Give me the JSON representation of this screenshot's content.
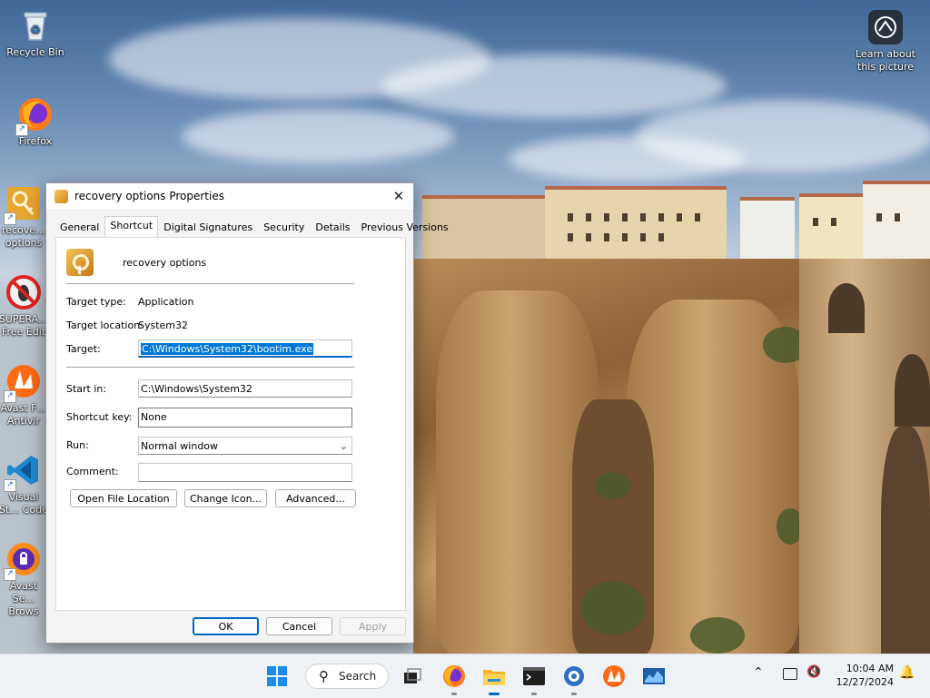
{
  "desktop": {
    "icons": [
      {
        "label": "Recycle Bin"
      },
      {
        "label": "Firefox"
      },
      {
        "label": "recove… options"
      },
      {
        "label": "SUPERA… Free Edit"
      },
      {
        "label": "Avast F… Antivir"
      },
      {
        "label": "Visual St… Code"
      },
      {
        "label": "Avast Se… Brows"
      }
    ],
    "learn_about": "Learn about this picture"
  },
  "dialog": {
    "title": "recovery options Properties",
    "close_glyph": "✕",
    "tabs": [
      "General",
      "Shortcut",
      "Digital Signatures",
      "Security",
      "Details",
      "Previous Versions"
    ],
    "active_tab": "Shortcut",
    "shortcut": {
      "name": "recovery options",
      "target_type_label": "Target type:",
      "target_type": "Application",
      "target_location_label": "Target location:",
      "target_location": "System32",
      "target_label": "Target:",
      "target": "C:\\Windows\\System32\\bootim.exe",
      "start_in_label": "Start in:",
      "start_in": "C:\\Windows\\System32",
      "shortcut_key_label": "Shortcut key:",
      "shortcut_key": "None",
      "run_label": "Run:",
      "run": "Normal window",
      "comment_label": "Comment:",
      "comment": "",
      "open_file_location": "Open File Location",
      "change_icon": "Change Icon...",
      "advanced": "Advanced..."
    },
    "buttons": {
      "ok": "OK",
      "cancel": "Cancel",
      "apply": "Apply"
    }
  },
  "taskbar": {
    "search_label": "Search",
    "time": "10:04 AM",
    "date": "12/27/2024",
    "apps": [
      "task-view",
      "firefox",
      "file-explorer",
      "terminal",
      "network-tool",
      "avast",
      "resource-monitor"
    ]
  },
  "colors": {
    "accent": "#0067c0",
    "selection": "#0078d7"
  }
}
